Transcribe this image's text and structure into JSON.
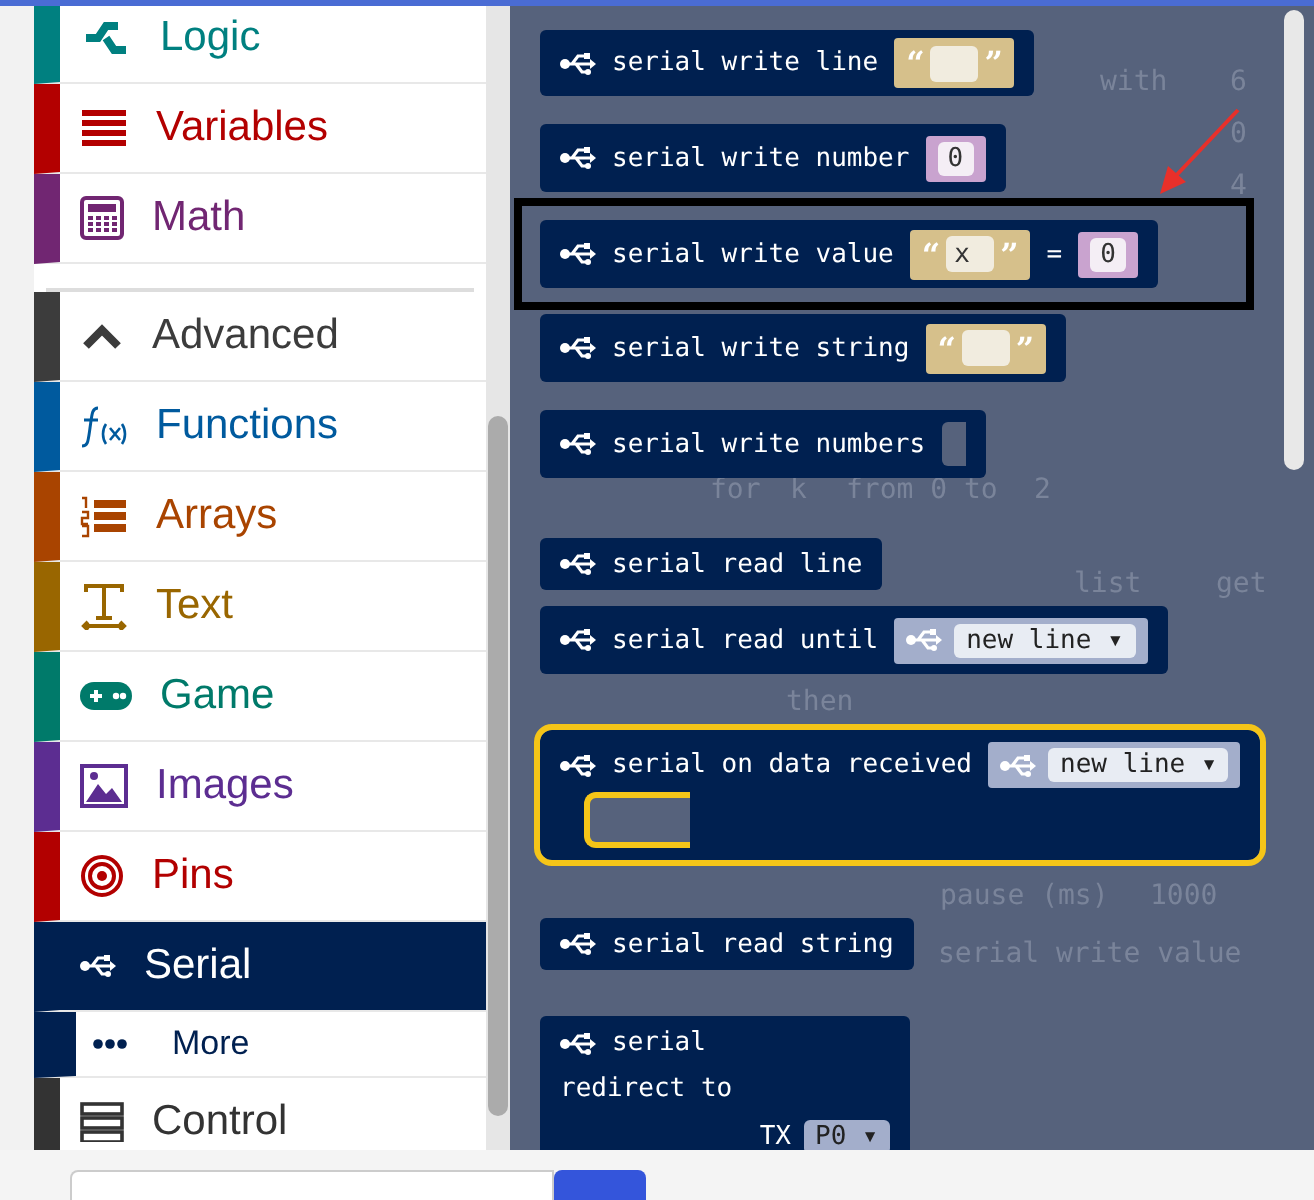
{
  "sidebar": {
    "items": [
      {
        "label": "Logic",
        "color": "#008080",
        "selected": false,
        "kind": "category"
      },
      {
        "label": "Variables",
        "color": "#b30000",
        "selected": false,
        "kind": "category"
      },
      {
        "label": "Math",
        "color": "#712672",
        "selected": false,
        "kind": "category"
      },
      {
        "label": "Advanced",
        "color": "#3c3c3c",
        "selected": false,
        "kind": "toggle"
      },
      {
        "label": "Functions",
        "color": "#005a9e",
        "selected": false,
        "kind": "category"
      },
      {
        "label": "Arrays",
        "color": "#a94400",
        "selected": false,
        "kind": "category"
      },
      {
        "label": "Text",
        "color": "#996600",
        "selected": false,
        "kind": "category"
      },
      {
        "label": "Game",
        "color": "#007a6a",
        "selected": false,
        "kind": "category"
      },
      {
        "label": "Images",
        "color": "#5c2d91",
        "selected": false,
        "kind": "category"
      },
      {
        "label": "Pins",
        "color": "#b20000",
        "selected": false,
        "kind": "category"
      },
      {
        "label": "Serial",
        "color": "#002050",
        "selected": true,
        "kind": "category"
      },
      {
        "label": "More",
        "color": "#002050",
        "selected": false,
        "kind": "sub"
      },
      {
        "label": "Control",
        "color": "#333333",
        "selected": false,
        "kind": "category"
      }
    ]
  },
  "workspace": {
    "labels": [
      "with",
      "6",
      "0",
      "4",
      "for",
      "k",
      "from 0 to",
      "2",
      "list",
      "get",
      "then",
      "pause (ms)",
      "1000",
      "serial write value"
    ]
  },
  "highlight_frame": true,
  "pointer_arrow": true,
  "flyout": {
    "blocks": [
      {
        "kind": "statement",
        "selected": false,
        "parts": [
          {
            "kind": "text",
            "text": "serial write line"
          },
          {
            "kind": "string",
            "quotes": [
              "“",
              "”"
            ]
          }
        ]
      },
      {
        "kind": "statement",
        "selected": false,
        "parts": [
          {
            "kind": "text",
            "text": "serial write number"
          },
          {
            "kind": "number",
            "text": "0"
          }
        ]
      },
      {
        "kind": "statement",
        "selected": false,
        "parts": [
          {
            "kind": "text",
            "text": "serial write value"
          },
          {
            "kind": "string",
            "text": "x",
            "quotes": [
              "“",
              "”"
            ]
          },
          {
            "kind": "text",
            "text": "="
          },
          {
            "kind": "number",
            "text": "0"
          }
        ]
      },
      {
        "kind": "statement",
        "selected": false,
        "parts": [
          {
            "kind": "text",
            "text": "serial write string"
          },
          {
            "kind": "string",
            "quotes": [
              "“",
              "”"
            ]
          }
        ]
      },
      {
        "kind": "statement",
        "selected": false,
        "parts": [
          {
            "kind": "text",
            "text": "serial write numbers"
          },
          {
            "kind": "slot"
          }
        ]
      },
      {
        "kind": "reporter",
        "selected": false,
        "parts": [
          {
            "kind": "text",
            "text": "serial read line"
          }
        ]
      },
      {
        "kind": "reporter",
        "selected": false,
        "parts": [
          {
            "kind": "text",
            "text": "serial read until"
          },
          {
            "kind": "dropdown",
            "text": "new line",
            "arrow": "▾"
          }
        ]
      },
      {
        "kind": "hat",
        "selected": true,
        "parts": [
          {
            "kind": "text",
            "text": "serial on data received"
          },
          {
            "kind": "dropdown",
            "text": "new line",
            "arrow": "▾"
          }
        ]
      },
      {
        "kind": "reporter",
        "selected": false,
        "parts": [
          {
            "kind": "text",
            "text": "serial read string"
          }
        ]
      },
      {
        "kind": "multi",
        "selected": false,
        "parts": [
          {
            "kind": "text",
            "text": "serial"
          },
          {
            "kind": "text",
            "text": "redirect to"
          },
          {
            "kind": "text",
            "text": "TX"
          },
          {
            "kind": "pin",
            "text": "P0",
            "arrow": "▾"
          }
        ]
      }
    ]
  }
}
